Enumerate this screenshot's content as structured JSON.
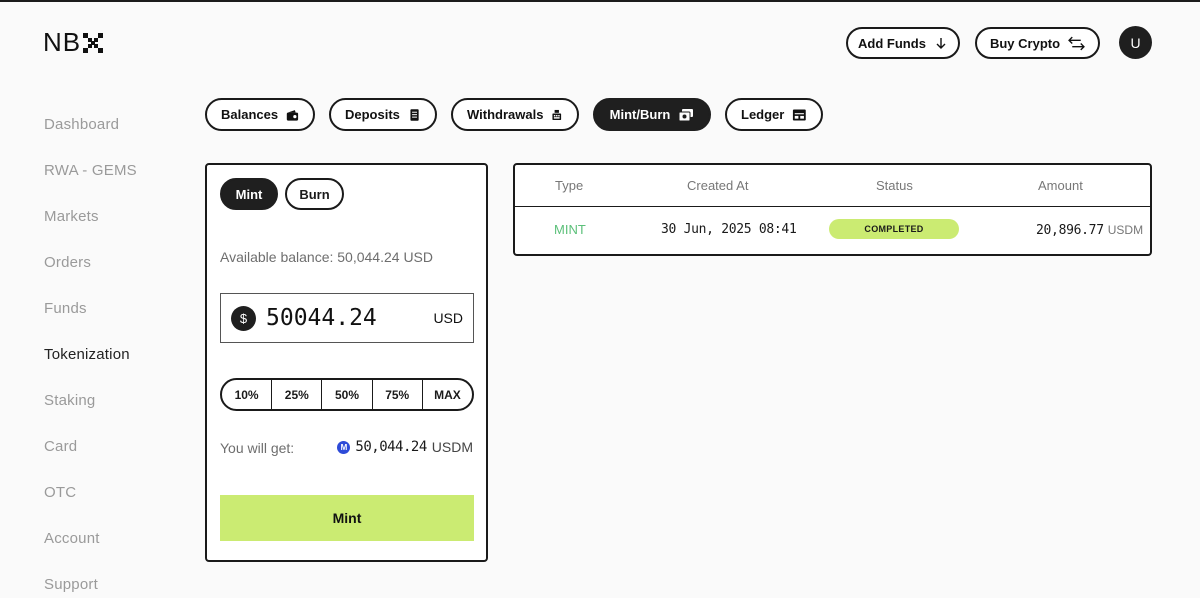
{
  "brand": {
    "logo_text": "NB"
  },
  "header": {
    "add_funds_label": "Add Funds",
    "buy_crypto_label": "Buy Crypto",
    "avatar_initial": "U"
  },
  "sidebar": {
    "items": [
      {
        "label": "Dashboard",
        "active": false
      },
      {
        "label": "RWA - GEMS",
        "active": false
      },
      {
        "label": "Markets",
        "active": false
      },
      {
        "label": "Orders",
        "active": false
      },
      {
        "label": "Funds",
        "active": false
      },
      {
        "label": "Tokenization",
        "active": true
      },
      {
        "label": "Staking",
        "active": false
      },
      {
        "label": "Card",
        "active": false
      },
      {
        "label": "OTC",
        "active": false
      },
      {
        "label": "Account",
        "active": false
      },
      {
        "label": "Support",
        "active": false
      }
    ]
  },
  "tabs": [
    {
      "label": "Balances",
      "icon": "wallet-icon",
      "active": false
    },
    {
      "label": "Deposits",
      "icon": "receipt-icon",
      "active": false
    },
    {
      "label": "Withdrawals",
      "icon": "register-icon",
      "active": false
    },
    {
      "label": "Mint/Burn",
      "icon": "cash-icon",
      "active": true
    },
    {
      "label": "Ledger",
      "icon": "ledger-icon",
      "active": false
    }
  ],
  "mint_panel": {
    "toggle": {
      "mint_label": "Mint",
      "burn_label": "Burn",
      "selected": "Mint"
    },
    "available_balance": "Available balance: 50,044.24 USD",
    "amount": {
      "value": "50044.24",
      "currency": "USD",
      "currency_symbol": "$"
    },
    "percent_options": [
      "10%",
      "25%",
      "50%",
      "75%",
      "MAX"
    ],
    "you_will_get_label": "You will get:",
    "you_will_get_value": "50,044.24",
    "you_will_get_currency": "USDM",
    "usdm_icon_letter": "M",
    "submit_label": "Mint"
  },
  "transactions": {
    "columns": [
      "Type",
      "Created At",
      "Status",
      "Amount"
    ],
    "rows": [
      {
        "type": "MINT",
        "created_at": "30 Jun, 2025 08:41",
        "status": "COMPLETED",
        "amount": "20,896.77",
        "currency": "USDM"
      }
    ]
  },
  "colors": {
    "accent_green": "#cbeb72",
    "mint_type_green": "#5cc07a",
    "dark": "#1f1f1f",
    "usdm_blue": "#2e4bd8"
  }
}
